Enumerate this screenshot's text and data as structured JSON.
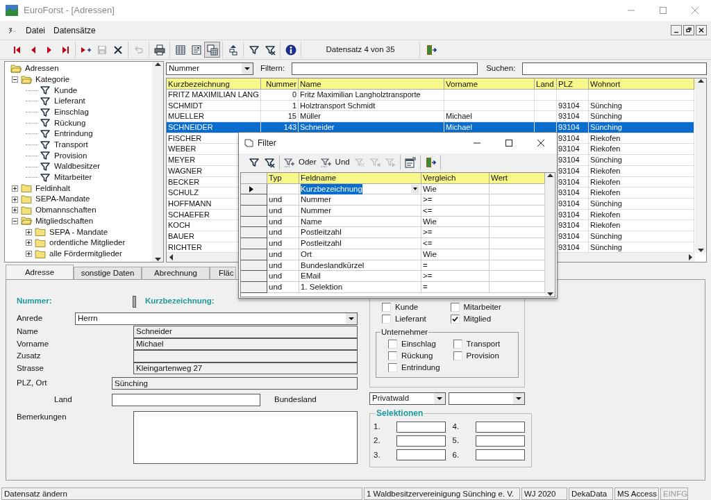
{
  "window": {
    "title": "EuroForst - [Adressen]"
  },
  "menu": [
    "Datei",
    "Datensätze"
  ],
  "toolbar": [
    [
      {
        "kind": "first",
        "disabled": false,
        "pressed": false
      },
      {
        "kind": "prev",
        "disabled": false,
        "pressed": false
      },
      {
        "kind": "next",
        "disabled": false,
        "pressed": false
      },
      {
        "kind": "last",
        "disabled": false,
        "pressed": false
      }
    ],
    [
      {
        "kind": "new",
        "disabled": false,
        "pressed": false
      },
      {
        "kind": "save",
        "disabled": true,
        "pressed": false
      },
      {
        "kind": "delete",
        "disabled": false,
        "pressed": false
      }
    ],
    [
      {
        "kind": "undo",
        "disabled": true,
        "pressed": false
      }
    ],
    [
      {
        "kind": "print",
        "disabled": false,
        "pressed": false
      }
    ],
    [
      {
        "kind": "table",
        "disabled": false,
        "pressed": false
      },
      {
        "kind": "form",
        "disabled": false,
        "pressed": false
      },
      {
        "kind": "both",
        "disabled": false,
        "pressed": true
      }
    ],
    [
      {
        "kind": "move",
        "disabled": false,
        "pressed": false
      }
    ],
    [
      {
        "kind": "filter",
        "disabled": false,
        "pressed": false
      },
      {
        "kind": "filter-clear",
        "disabled": false,
        "pressed": false
      }
    ],
    [
      {
        "kind": "info",
        "disabled": false,
        "pressed": false
      }
    ]
  ],
  "record_counter": "Datensatz 4 von 35",
  "tree": {
    "label": "Adressen",
    "kind": "folder",
    "expanded": true,
    "children": [
      {
        "label": "Kategorie",
        "kind": "folder",
        "expanded": true,
        "children": [
          {
            "label": "Kunde",
            "kind": "filter"
          },
          {
            "label": "Lieferant",
            "kind": "filter"
          },
          {
            "label": "Einschlag",
            "kind": "filter"
          },
          {
            "label": "Rückung",
            "kind": "filter"
          },
          {
            "label": "Entrindung",
            "kind": "filter"
          },
          {
            "label": "Transport",
            "kind": "filter"
          },
          {
            "label": "Provision",
            "kind": "filter"
          },
          {
            "label": "Waldbesitzer",
            "kind": "filter"
          },
          {
            "label": "Mitarbeiter",
            "kind": "filter"
          }
        ]
      },
      {
        "label": "Feldinhalt",
        "kind": "folder",
        "expanded": false
      },
      {
        "label": "SEPA-Mandate",
        "kind": "folder",
        "expanded": false
      },
      {
        "label": "Obmannschaften",
        "kind": "folder",
        "expanded": false
      },
      {
        "label": "Mitgliedschaften",
        "kind": "folder",
        "expanded": true,
        "children": [
          {
            "label": "SEPA - Mandate",
            "kind": "folder",
            "expanded": false
          },
          {
            "label": "ordentliche Mitglieder",
            "kind": "folder",
            "expanded": false
          },
          {
            "label": "alle  Fördermitglieder",
            "kind": "folder",
            "expanded": false
          }
        ]
      }
    ]
  },
  "record_list": {
    "sort_field": "Nummer",
    "filter_label": "Filtern:",
    "search_label": "Suchen:",
    "columns": [
      "Kurzbezeichnung",
      "Nummer",
      "Name",
      "Vorname",
      "Land",
      "PLZ",
      "Wohnort"
    ],
    "rows": [
      {
        "selected": false,
        "cells": [
          "FRITZ MAXIMILIAN LANG",
          "0",
          "Fritz Maximilian Langholztransporte",
          null,
          null,
          null,
          null
        ]
      },
      {
        "selected": false,
        "cells": [
          "SCHMIDT",
          "1",
          "Holztransport Schmidt",
          null,
          null,
          "93104",
          "Sünching"
        ]
      },
      {
        "selected": false,
        "cells": [
          "MUELLER",
          "15",
          "Müller",
          "Michael",
          null,
          "93104",
          "Sünching"
        ]
      },
      {
        "selected": true,
        "cells": [
          "SCHNEIDER",
          "143",
          "Schneider",
          "Michael",
          null,
          "93104",
          "Sünching"
        ]
      },
      {
        "selected": false,
        "cells": [
          "FISCHER",
          null,
          null,
          null,
          null,
          "93104",
          "Riekofen"
        ]
      },
      {
        "selected": false,
        "cells": [
          "WEBER",
          null,
          null,
          null,
          null,
          "93104",
          "Riekofen"
        ]
      },
      {
        "selected": false,
        "cells": [
          "MEYER",
          null,
          null,
          null,
          null,
          "93104",
          "Sünching"
        ]
      },
      {
        "selected": false,
        "cells": [
          "WAGNER",
          null,
          null,
          null,
          null,
          "93104",
          "Riekofen"
        ]
      },
      {
        "selected": false,
        "cells": [
          "BECKER",
          null,
          null,
          null,
          null,
          "93104",
          "Riekofen"
        ]
      },
      {
        "selected": false,
        "cells": [
          "SCHULZ",
          null,
          null,
          null,
          null,
          "93104",
          "Riekofen"
        ]
      },
      {
        "selected": false,
        "cells": [
          "HOFFMANN",
          null,
          null,
          null,
          null,
          "93104",
          "Sünching"
        ]
      },
      {
        "selected": false,
        "cells": [
          "SCHAEFER",
          null,
          null,
          null,
          null,
          "93104",
          "Riekofen"
        ]
      },
      {
        "selected": false,
        "cells": [
          "KOCH",
          null,
          null,
          null,
          null,
          "93104",
          "Riekofen"
        ]
      },
      {
        "selected": false,
        "cells": [
          "BAUER",
          null,
          null,
          null,
          null,
          "93104",
          "Sünching"
        ]
      },
      {
        "selected": false,
        "cells": [
          "RICHTER",
          null,
          null,
          null,
          null,
          "93104",
          "Sünching"
        ]
      }
    ]
  },
  "tabs": [
    {
      "label": "Adresse",
      "selected": true
    },
    {
      "label": "sonstige Daten",
      "selected": false
    },
    {
      "label": "Abrechnung",
      "selected": false
    },
    {
      "label": "Fläc",
      "selected": false
    }
  ],
  "form": {
    "nummer_label": "Nummer:",
    "kurz_label": "Kurzbezeichnung:",
    "anrede": {
      "label": "Anrede",
      "value": "Herrn"
    },
    "fields": [
      {
        "label": "Name",
        "value": "Schneider"
      },
      {
        "label": "Vorname",
        "value": "Michael"
      },
      {
        "label": "Zusatz"
      },
      {
        "label": "Strasse",
        "value": "Kleingartenweg 27"
      }
    ],
    "plz_ort": {
      "label": "PLZ, Ort",
      "value": "Sünching"
    },
    "land": {
      "label": "Land"
    },
    "bundesland": {
      "label": "Bundesland"
    },
    "bemerkungen": {
      "label": "Bemerkungen"
    },
    "categories": [
      {
        "label": "Kunde",
        "checked": false
      },
      {
        "label": "Mitarbeiter",
        "checked": false
      },
      {
        "label": "Lieferant",
        "checked": false
      },
      {
        "label": "Mitglied",
        "checked": true
      }
    ],
    "unternehmer": {
      "title": "Unternehmer",
      "options": [
        {
          "label": "Einschlag",
          "checked": false
        },
        {
          "label": "Transport",
          "checked": false
        },
        {
          "label": "Rückung",
          "checked": false
        },
        {
          "label": "Provision",
          "checked": false
        },
        {
          "label": "Entrindung",
          "checked": false
        }
      ]
    },
    "waldart": "Privatwald",
    "selektionen": {
      "title": "Selektionen",
      "labels": [
        "1.",
        "4.",
        "2.",
        "5.",
        "3.",
        "6."
      ]
    }
  },
  "filter_dialog": {
    "title": "Filter",
    "toolbar": [
      [
        {
          "kind": "apply",
          "disabled": false
        },
        {
          "kind": "clear",
          "disabled": false
        }
      ],
      [
        {
          "kind": "or",
          "label": "Oder",
          "disabled": false
        },
        {
          "kind": "and",
          "label": "Und",
          "disabled": false
        },
        {
          "kind": "remove",
          "disabled": true
        },
        {
          "kind": "left",
          "disabled": true
        },
        {
          "kind": "right",
          "disabled": true
        }
      ],
      [
        {
          "kind": "properties",
          "disabled": false
        }
      ],
      [
        {
          "kind": "exit",
          "disabled": false
        }
      ]
    ],
    "columns": [
      "Typ",
      "Feldname",
      "Vergleich",
      "Wert"
    ],
    "rows": [
      {
        "current": true,
        "cells": [
          null,
          "Kurzbezeichnung",
          "Wie",
          null
        ]
      },
      {
        "current": false,
        "cells": [
          "und",
          "Nummer",
          ">=",
          null
        ]
      },
      {
        "current": false,
        "cells": [
          "und",
          "Nummer",
          "<=",
          null
        ]
      },
      {
        "current": false,
        "cells": [
          "und",
          "Name",
          "Wie",
          null
        ]
      },
      {
        "current": false,
        "cells": [
          "und",
          "Postleitzahl",
          ">=",
          null
        ]
      },
      {
        "current": false,
        "cells": [
          "und",
          "Postleitzahl",
          "<=",
          null
        ]
      },
      {
        "current": false,
        "cells": [
          "und",
          "Ort",
          "Wie",
          null
        ]
      },
      {
        "current": false,
        "cells": [
          "und",
          "Bundeslandkürzel",
          "=",
          null
        ]
      },
      {
        "current": false,
        "cells": [
          "und",
          "EMail",
          ">=",
          null
        ]
      },
      {
        "current": false,
        "cells": [
          "und",
          "1. Selektion",
          "=",
          null
        ]
      }
    ]
  },
  "status_bar": [
    {
      "text": "Datensatz ändern",
      "disabled": false
    },
    {
      "text": "1 Waldbesitzervereinigung Sünching e. V.",
      "disabled": false
    },
    {
      "text": "WJ 2020",
      "disabled": false
    },
    {
      "text": "DekaData",
      "disabled": false
    },
    {
      "text": "MS Access",
      "disabled": false
    },
    {
      "text": "EINFG",
      "disabled": true
    }
  ]
}
